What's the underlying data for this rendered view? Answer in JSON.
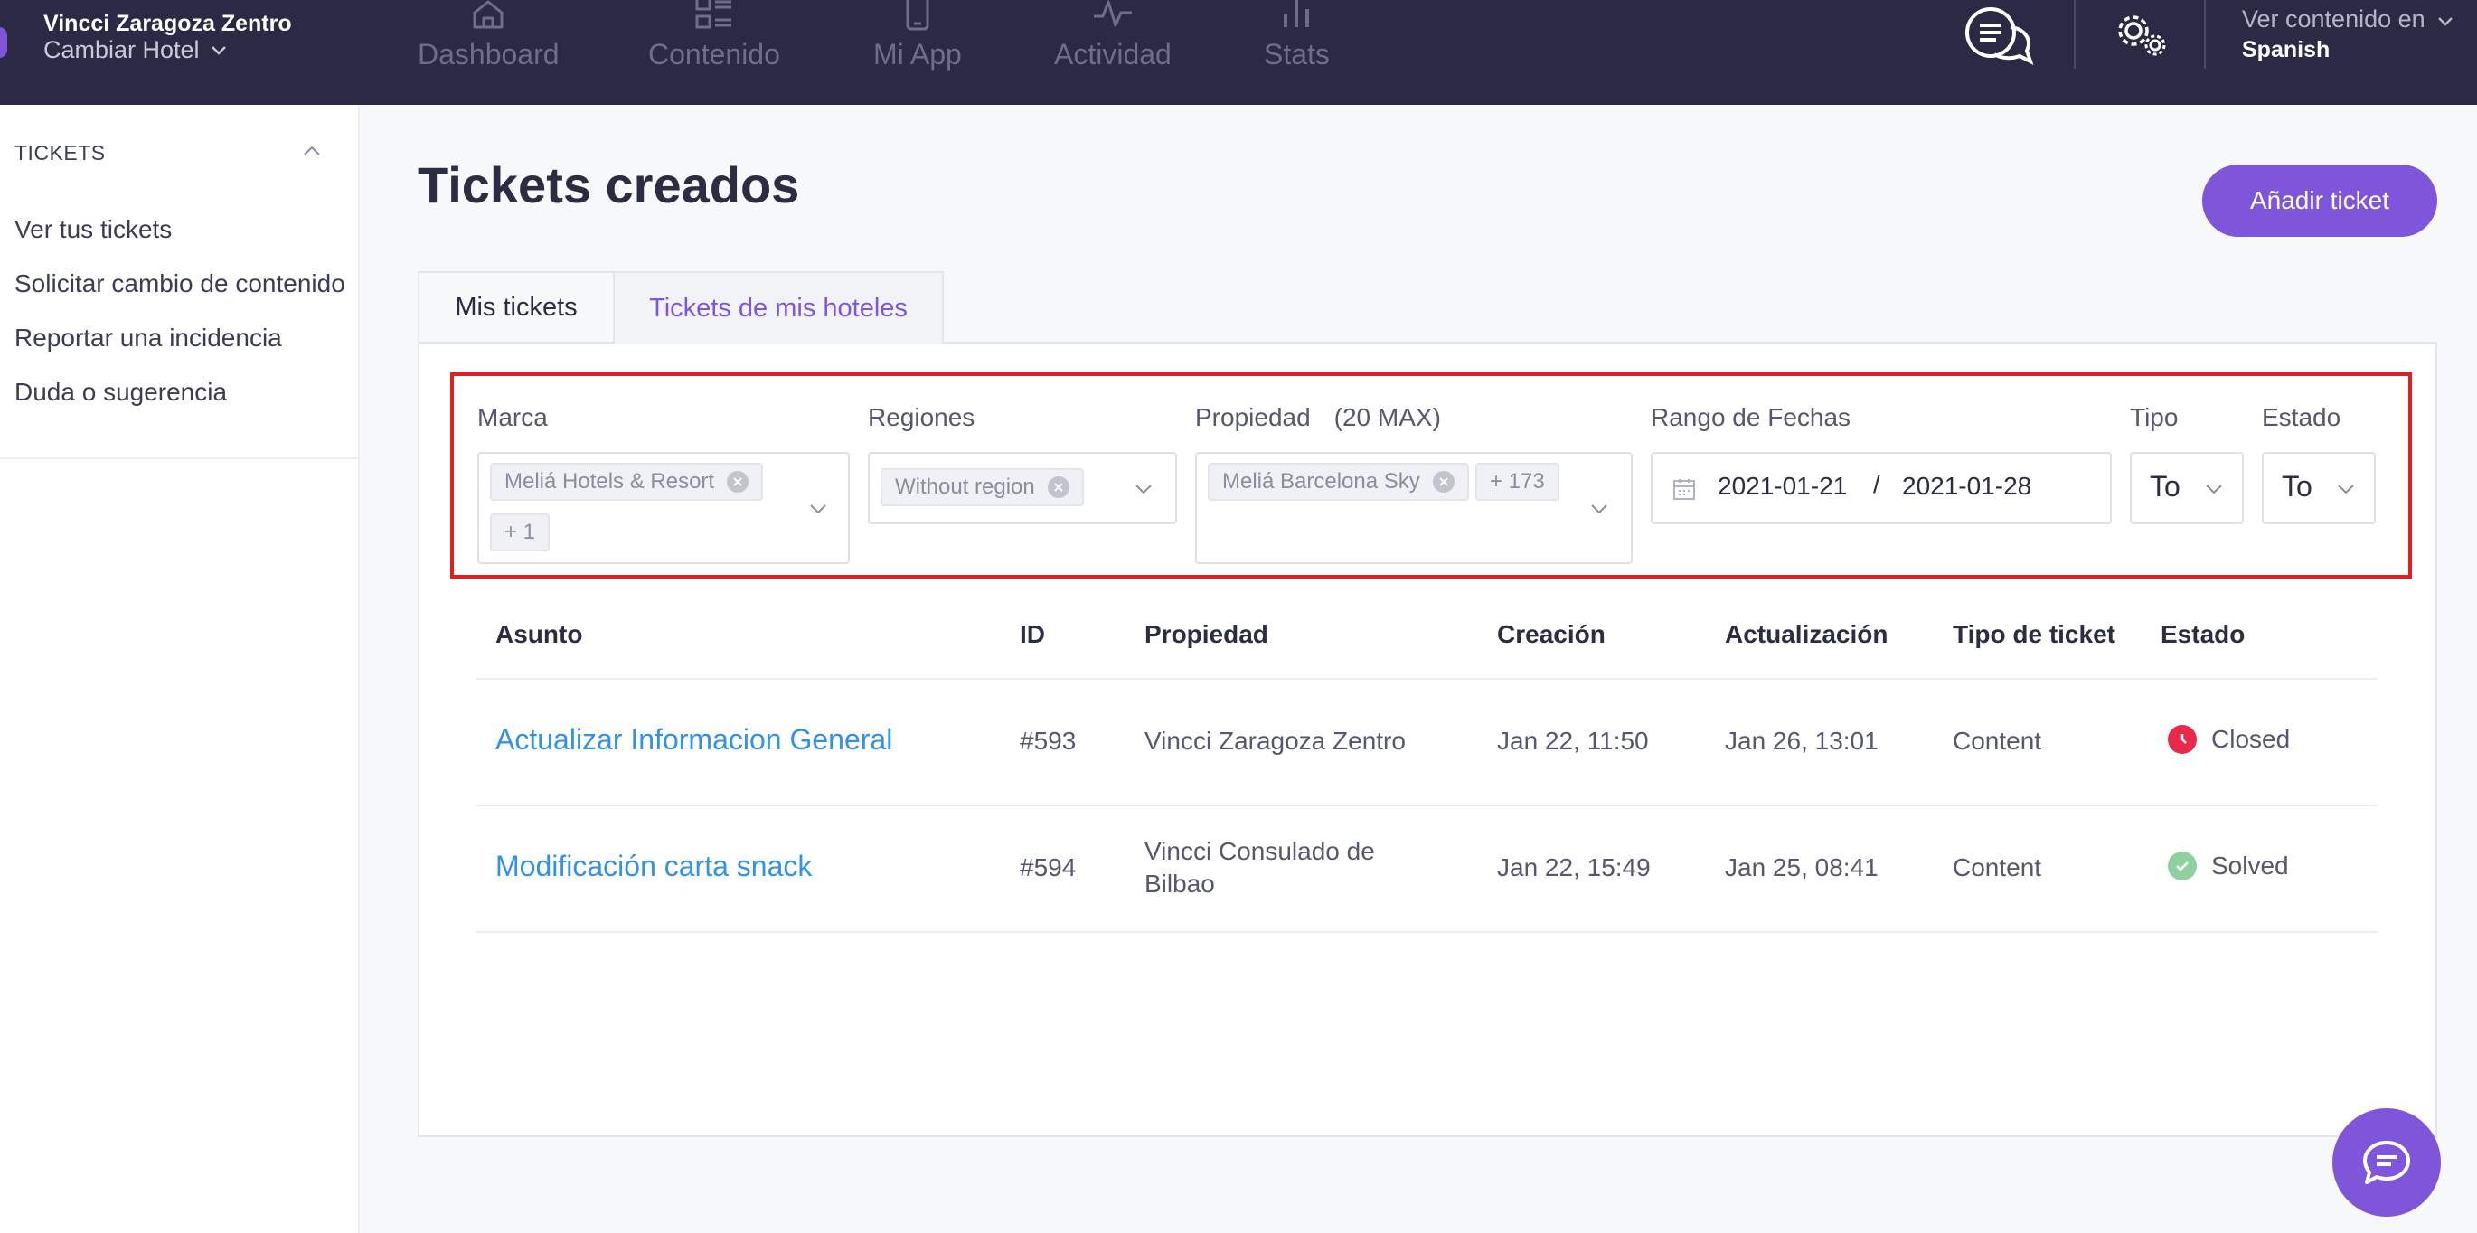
{
  "header": {
    "hotel_name": "Vincci Zaragoza Zentro",
    "change_hotel": "Cambiar Hotel",
    "nav": [
      {
        "label": "Dashboard",
        "icon": "home-icon"
      },
      {
        "label": "Contenido",
        "icon": "content-grid-icon"
      },
      {
        "label": "Mi App",
        "icon": "phone-icon"
      },
      {
        "label": "Actividad",
        "icon": "activity-icon"
      },
      {
        "label": "Stats",
        "icon": "bar-chart-icon"
      }
    ],
    "language_prompt": "Ver contenido en",
    "language_value": "Spanish"
  },
  "sidebar": {
    "section_title": "TICKETS",
    "items": [
      {
        "label": "Ver tus tickets"
      },
      {
        "label": "Solicitar cambio de contenido"
      },
      {
        "label": "Reportar una incidencia"
      },
      {
        "label": "Duda o sugerencia"
      }
    ]
  },
  "main": {
    "title": "Tickets creados",
    "add_button": "Añadir ticket",
    "tabs": [
      {
        "label": "Mis tickets",
        "active": false
      },
      {
        "label": "Tickets de mis hoteles",
        "active": true
      }
    ]
  },
  "filters": {
    "marca": {
      "label": "Marca",
      "chips": [
        "Meliá Hotels & Resort",
        "+ 1"
      ]
    },
    "regiones": {
      "label": "Regiones",
      "chips": [
        "Without region"
      ]
    },
    "propiedad": {
      "label": "Propiedad",
      "note": "(20 MAX)",
      "chips": [
        "Meliá Barcelona Sky",
        "+ 173"
      ]
    },
    "fechas": {
      "label": "Rango de Fechas",
      "start": "2021-01-21",
      "separator": "/",
      "end": "2021-01-28"
    },
    "tipo": {
      "label": "Tipo",
      "value": "To"
    },
    "estado": {
      "label": "Estado",
      "value": "To"
    }
  },
  "table": {
    "columns": [
      "Asunto",
      "ID",
      "Propiedad",
      "Creación",
      "Actualización",
      "Tipo de ticket",
      "Estado"
    ],
    "rows": [
      {
        "asunto": "Actualizar Informacion General",
        "id": "#593",
        "propiedad_1": "Vincci Zaragoza Zentro",
        "propiedad_2": "",
        "creacion": "Jan 22, 11:50",
        "actualizacion": "Jan 26, 13:01",
        "tipo": "Content",
        "estado": "Closed"
      },
      {
        "asunto": "Modificación carta snack",
        "id": "#594",
        "propiedad_1": "Vincci Consulado de",
        "propiedad_2": "Bilbao",
        "creacion": "Jan 22, 15:49",
        "actualizacion": "Jan 25, 08:41",
        "tipo": "Content",
        "estado": "Solved"
      }
    ]
  },
  "colors": {
    "topbar": "#2a2a45",
    "accent": "#7f56d9",
    "link": "#3291e8",
    "closed": "#e8294a",
    "solved": "#8fd19e",
    "highlight": "#e02020"
  }
}
